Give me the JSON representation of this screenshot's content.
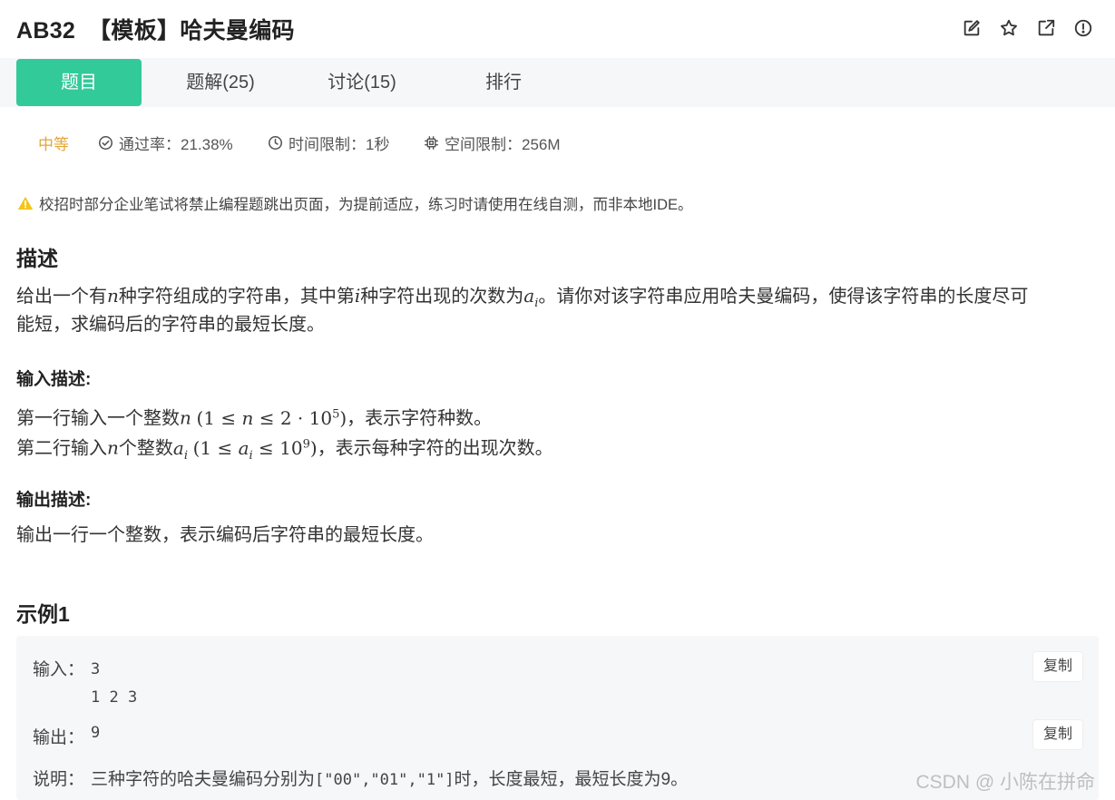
{
  "header": {
    "code": "AB32",
    "title": "【模板】哈夫曼编码",
    "icons": [
      "edit-icon",
      "star-icon",
      "external-link-icon",
      "report-icon"
    ]
  },
  "tabs": [
    {
      "label": "题目",
      "active": true
    },
    {
      "label": "题解(25)",
      "active": false
    },
    {
      "label": "讨论(15)",
      "active": false
    },
    {
      "label": "排行",
      "active": false
    }
  ],
  "meta": {
    "difficulty": "中等",
    "pass_rate": "通过率：21.38%",
    "time_limit": "时间限制：1秒",
    "memory_limit": "空间限制：256M"
  },
  "notice": "校招时部分企业笔试将禁止编程题跳出页面，为提前适应，练习时请使用在线自测，而非本地IDE。",
  "description": {
    "heading": "描述",
    "line1_a": "给出一个有",
    "line1_b": "种字符组成的字符串，其中第",
    "line1_c": "种字符出现的次数为",
    "line1_d": "。请你对该字符串应用哈夫曼编码，使得该字符串的长度尽可",
    "line2": "能短，求编码后的字符串的最短长度。"
  },
  "input": {
    "heading": "输入描述:",
    "line1_a": "第一行输入一个整数",
    "line1_b": "，表示字符种数。",
    "line2_a": "第二行输入",
    "line2_b": "个整数",
    "line2_c": "，表示每种字符的出现次数。"
  },
  "output": {
    "heading": "输出描述:",
    "line1": "输出一行一个整数，表示编码后字符串的最短长度。"
  },
  "example": {
    "heading": "示例1",
    "input_label": "输入：",
    "input_value": "3\n1 2 3",
    "output_label": "输出：",
    "output_value": "9",
    "explain_label": "说明：",
    "explain_a": "三种字符的哈夫曼编码分别为",
    "explain_code": "[\"00\",\"01\",\"1\"]",
    "explain_b": "时，长度最短，最短长度为9。",
    "copy_label": "复制"
  },
  "watermark": "CSDN @ 小陈在拼命",
  "colors": {
    "accent": "#32ca99",
    "difficulty": "#e5a43a",
    "warning": "#f5c518"
  }
}
